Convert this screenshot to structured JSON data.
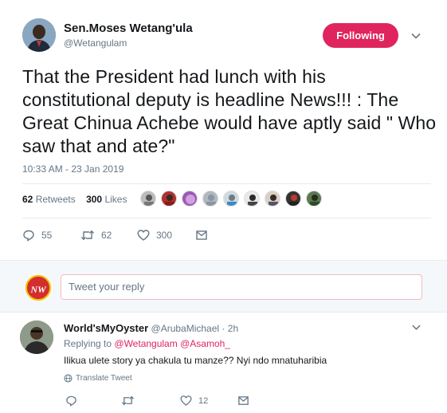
{
  "tweet": {
    "author_name": "Sen.Moses Wetang'ula",
    "author_handle": "@Wetangulam",
    "follow_label": "Following",
    "text": "That the President had lunch with his constitutional deputy is headline News!!! : The Great Chinua Achebe would have aptly said \" Who saw that and ate?\"",
    "timestamp": "10:33 AM - 23 Jan 2019",
    "retweets_count": "62",
    "retweets_label": "Retweets",
    "likes_count": "300",
    "likes_label": "Likes",
    "actions": {
      "reply_count": "55",
      "retweet_count": "62",
      "like_count": "300"
    }
  },
  "reply_box": {
    "user_logo_text": "NW",
    "placeholder": "Tweet your reply"
  },
  "reply": {
    "author_name": "World'sMyOyster",
    "author_handle": "@ArubaMichael",
    "separator": "·",
    "time": "2h",
    "replying_to_label": "Replying to",
    "mention_1": "@Wetangulam",
    "mention_2": "@Asamoh_",
    "text": "Ilikua ulete story ya chakula tu manze?? Nyi ndo mnatuharibia",
    "translate_label": "Translate Tweet",
    "like_count": "12"
  },
  "colors": {
    "accent": "#e0245e",
    "muted": "#657786",
    "text": "#14171a"
  },
  "icons": [
    "caret-down-icon",
    "reply-icon",
    "retweet-icon",
    "heart-icon",
    "message-icon",
    "globe-icon"
  ]
}
